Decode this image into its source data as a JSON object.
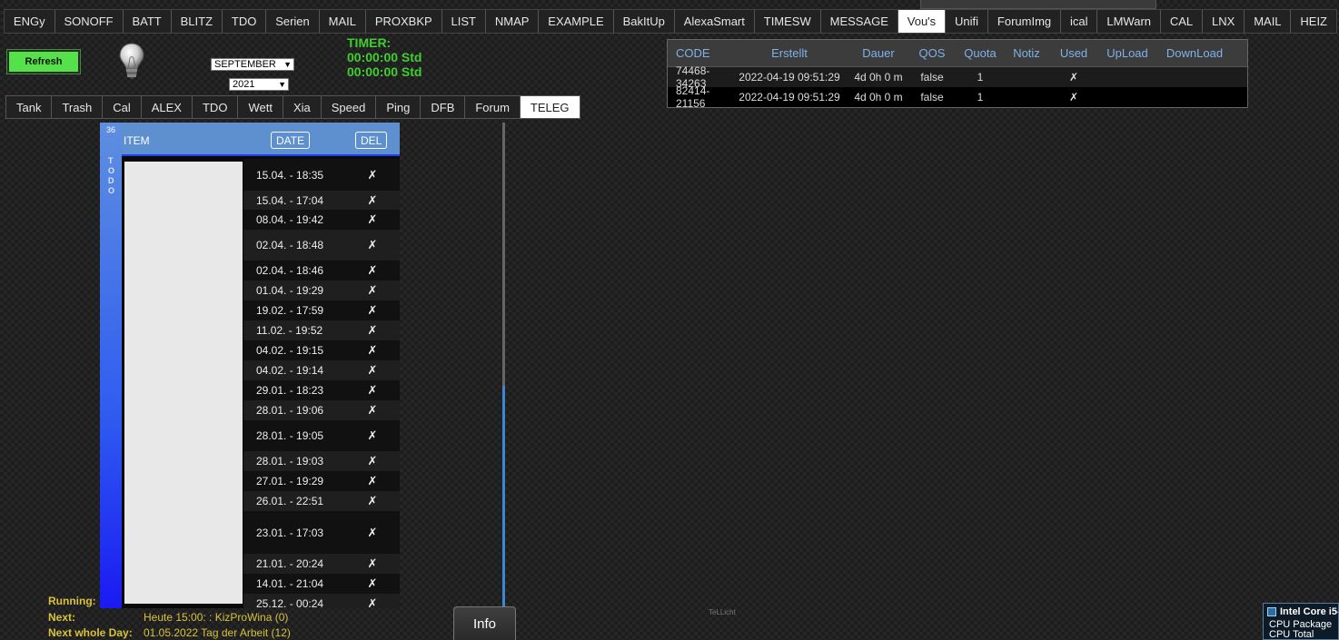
{
  "nav": {
    "tabs": [
      "ENGy",
      "SONOFF",
      "BATT",
      "BLITZ",
      "TDO",
      "Serien",
      "MAIL",
      "PROXBKP",
      "LIST",
      "NMAP",
      "EXAMPLE",
      "BakItUp",
      "AlexaSmart",
      "TIMESW",
      "MESSAGE",
      "Vou's",
      "Unifi",
      "ForumImg",
      "ical",
      "LMWarn",
      "CAL",
      "LNX",
      "MAIL",
      "HEIZ"
    ],
    "active": "Vou's"
  },
  "controls": {
    "refresh_label": "Refresh",
    "month_value": "SEPTEMBER",
    "year_value": "2021"
  },
  "timer": {
    "label": "TIMER:",
    "line1": "00:00:00 Std",
    "line2": "00:00:00 Std"
  },
  "subnav": {
    "tabs": [
      "Tank",
      "Trash",
      "Cal",
      "ALEX",
      "TDO",
      "Wett",
      "Xia",
      "Speed",
      "Ping",
      "DFB",
      "Forum",
      "TELEG"
    ],
    "active": "TELEG"
  },
  "vouchers": {
    "headers": [
      "CODE",
      "Erstellt",
      "Dauer",
      "QOS",
      "Quota",
      "Notiz",
      "Used",
      "UpLoad",
      "DownLoad"
    ],
    "rows": [
      {
        "code": "74468-34263",
        "erstellt": "2022-04-19 09:51:29",
        "dauer": "4d 0h 0 m",
        "qos": "false",
        "quota": "1",
        "notiz": "",
        "used": "✗",
        "upload": "",
        "download": ""
      },
      {
        "code": "82414-21156",
        "erstellt": "2022-04-19 09:51:29",
        "dauer": "4d 0h 0 m",
        "qos": "false",
        "quota": "1",
        "notiz": "",
        "used": "✗",
        "upload": "",
        "download": ""
      }
    ]
  },
  "todo": {
    "count": "36",
    "side_label": "TODO",
    "item_header": "ITEM",
    "date_header": "DATE",
    "del_header": "DEL",
    "del_glyph": "✗",
    "rows": [
      {
        "date": "15.04. - 18:35",
        "h": 35
      },
      {
        "date": "15.04. - 17:04",
        "h": 21
      },
      {
        "date": "08.04. - 19:42",
        "h": 22
      },
      {
        "date": "02.04. - 18:48",
        "h": 34
      },
      {
        "date": "02.04. - 18:46",
        "h": 22
      },
      {
        "date": "01.04. - 19:29",
        "h": 22
      },
      {
        "date": "19.02. - 17:59",
        "h": 22
      },
      {
        "date": "11.02. - 19:52",
        "h": 22
      },
      {
        "date": "04.02. - 19:15",
        "h": 22
      },
      {
        "date": "04.02. - 19:14",
        "h": 22
      },
      {
        "date": "29.01. - 18:23",
        "h": 22
      },
      {
        "date": "28.01. - 19:06",
        "h": 22
      },
      {
        "date": "28.01. - 19:05",
        "h": 34
      },
      {
        "date": "28.01. - 19:03",
        "h": 22
      },
      {
        "date": "27.01. - 19:29",
        "h": 22
      },
      {
        "date": "26.01. - 22:51",
        "h": 22
      },
      {
        "date": "23.01. - 17:03",
        "h": 47
      },
      {
        "date": "21.01. - 20:24",
        "h": 22
      },
      {
        "date": "14.01. - 21:04",
        "h": 22
      },
      {
        "date": "25.12. - 00:24",
        "h": 22
      }
    ]
  },
  "bottom": {
    "running_label": "Running:",
    "next_label": "Next:",
    "next_value": "Heute 15:00: : KizProWina (0)",
    "whole_label": "Next whole Day:",
    "whole_value": "01.05.2022 Tag der Arbeit (12)",
    "info_label": "Info",
    "tiny_text": "TeLLicht"
  },
  "cpu": {
    "title": "Intel Core i5-",
    "line1": "CPU Package",
    "line2": "CPU Total"
  }
}
